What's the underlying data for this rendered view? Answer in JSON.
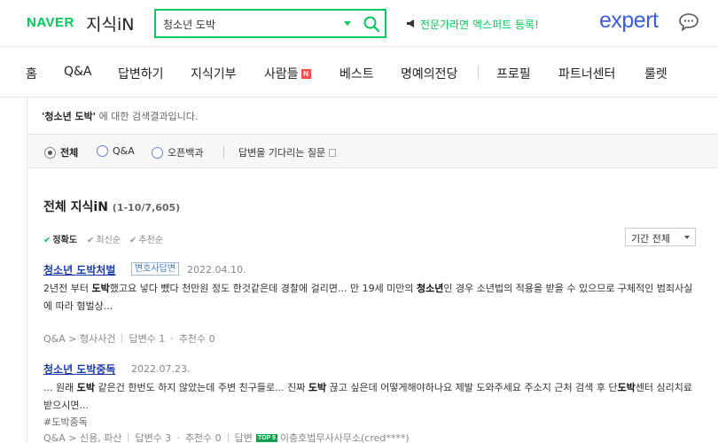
{
  "header": {
    "logo_naver": "NAVER",
    "logo_kin": "지식iN",
    "search_value": "청소년 도박",
    "promo_text": "전문가라면 엑스퍼트 등록!",
    "expert_logo": "expert",
    "brand_color": "#03c75a",
    "expert_color": "#3c5fd8"
  },
  "nav": {
    "items": [
      {
        "label": "홈"
      },
      {
        "label": "Q&A"
      },
      {
        "label": "답변하기"
      },
      {
        "label": "지식기부"
      },
      {
        "label": "사람들",
        "badge": "N"
      },
      {
        "label": "베스트"
      },
      {
        "label": "명예의전당"
      },
      {
        "label": "프로필"
      },
      {
        "label": "파트너센터"
      },
      {
        "label": "룰렛"
      }
    ]
  },
  "result_note": {
    "query": "'청소년 도박'",
    "suffix": " 에 대한 검색결과입니다."
  },
  "filters": {
    "radios": [
      {
        "label": "전체",
        "checked": true
      },
      {
        "label": "Q&A",
        "checked": false
      },
      {
        "label": "오픈백과",
        "checked": false
      }
    ],
    "waiting_link": "답변을 기다리는 질문"
  },
  "results": {
    "title": "전체 지식iN",
    "count": "(1-10/7,605)",
    "sort": [
      {
        "label": "정확도",
        "active": true
      },
      {
        "label": "최신순",
        "active": false
      },
      {
        "label": "추천순",
        "active": false
      }
    ],
    "period_select": "기간 전체",
    "items": [
      {
        "title": "청소년 도박처벌",
        "badge": "변호사답변",
        "date": "2022.04.10.",
        "body": "2년전 부터 <b>도박</b>했고요 넣다 뺐다 천만원 정도 한것같은데 경찰에 걸리면... 만 19세 미만의 <b>청소년</b>인 경우 소년법의 적용을 받을 수 있으므로 구체적인 범죄사실에 따라 형벌상...",
        "meta": {
          "category": "Q&A > 형사사건",
          "answers": "답변수 1",
          "recommends": "추천수 0"
        }
      },
      {
        "title": "청소년 도박중독",
        "date": "2022.07.23.",
        "body": "... 원래 <b>도박</b> 같은건 한번도 하지 않았는데 주변 친구들로... 진짜 <b>도박</b> 끊고 싶은데 어떻게해야하나요 제발 도와주세요 주소지 근처 검색 후 단<b>도박</b>센터 심리치료 받으시면...",
        "tag": "#도박중독",
        "meta": {
          "category": "Q&A > 신용, 파산",
          "answers": "답변수 3",
          "recommends": "추천수 0",
          "answerer_label": "답변",
          "answerer_badge": "TOP 5",
          "answerer": "이충호법무사사무소(cred****)"
        }
      }
    ]
  }
}
